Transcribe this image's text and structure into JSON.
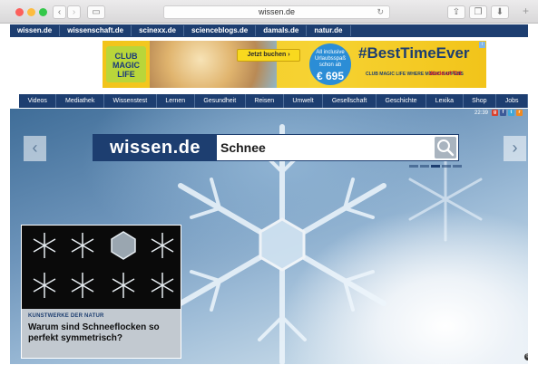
{
  "browser": {
    "url": "wissen.de",
    "back_glyph": "‹",
    "forward_glyph": "›",
    "sidebar_glyph": "▭",
    "reload_glyph": "↻",
    "share_glyph": "⇪",
    "tabs_glyph": "❐",
    "download_glyph": "⬇",
    "newtab_glyph": "+"
  },
  "partner_links": [
    "wissen.de",
    "wissenschaft.de",
    "scinexx.de",
    "scienceblogs.de",
    "damals.de",
    "natur.de"
  ],
  "ad": {
    "logo": "CLUB MAGIC LIFE",
    "button": "Jetzt buchen ›",
    "badge_text": "All inclusive Urlaubsspaß schon ab",
    "badge_price": "€ 695",
    "hashtag": "#BestTimeEver",
    "tagline": "CLUB MAGIC LIFE WHERE MAGIC HAPPENS",
    "brand": "World of TUI",
    "info": "i"
  },
  "main_nav": [
    "Videos",
    "Mediathek",
    "Wissenstest",
    "Lernen",
    "Gesundheit",
    "Reisen",
    "Umwelt",
    "Gesellschaft",
    "Geschichte",
    "Lexika",
    "Shop",
    "Jobs"
  ],
  "hero": {
    "clock": "22:39",
    "logo": "wissen.de",
    "search_value": "Schnee",
    "arrow_left": "‹",
    "arrow_right": "›",
    "copyright": "©"
  },
  "teaser": {
    "kicker": "KUNSTWERKE DER NATUR",
    "title": "Warum sind Schneeflocken so perfekt symmetrisch?"
  },
  "icons": [
    "back-icon",
    "forward-icon",
    "sidebar-icon",
    "reload-icon",
    "share-icon",
    "tabs-icon",
    "download-icon",
    "search-icon",
    "snowflake-icon",
    "social-google-icon",
    "social-facebook-icon",
    "social-twitter-icon",
    "social-rss-icon"
  ],
  "colors": {
    "brand_navy": "#1d3e70",
    "ad_yellow": "#f2c41a",
    "snow_sky": "#6e95bb"
  }
}
